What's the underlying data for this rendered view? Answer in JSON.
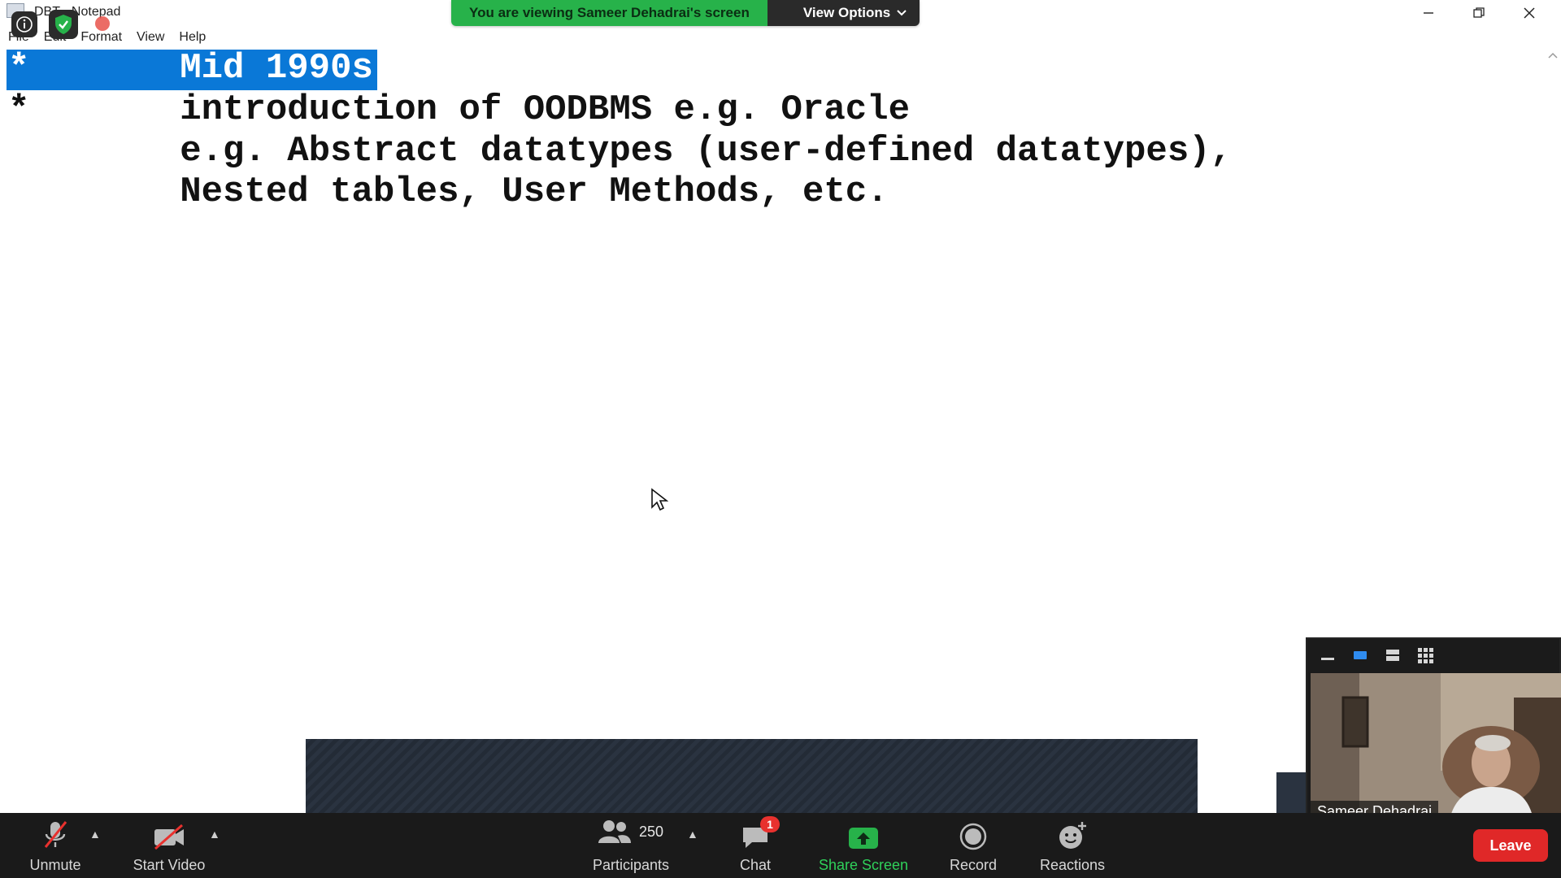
{
  "window": {
    "title": "DBT - Notepad",
    "menu": [
      "File",
      "Edit",
      "Format",
      "View",
      "Help"
    ]
  },
  "share_banner": {
    "text": "You are viewing Sameer Dehadrai's screen",
    "view_options": "View Options"
  },
  "document": {
    "lines": [
      "*       Mid 1990s",
      "*       introduction of OODBMS e.g. Oracle",
      "        e.g. Abstract datatypes (user-defined datatypes),",
      "        Nested tables, User Methods, etc."
    ],
    "selected_text": "Mid 1990s"
  },
  "video": {
    "participant_name": "Sameer Dehadrai"
  },
  "toolbar": {
    "unmute": "Unmute",
    "start_video": "Start Video",
    "participants": "Participants",
    "participant_count": "250",
    "chat": "Chat",
    "chat_badge": "1",
    "share_screen": "Share Screen",
    "record": "Record",
    "reactions": "Reactions",
    "leave": "Leave"
  },
  "colors": {
    "selection": "#0a78d7",
    "share_green": "#27b24a",
    "leave_red": "#e02828",
    "toolbar_bg": "#1a1a1a"
  }
}
